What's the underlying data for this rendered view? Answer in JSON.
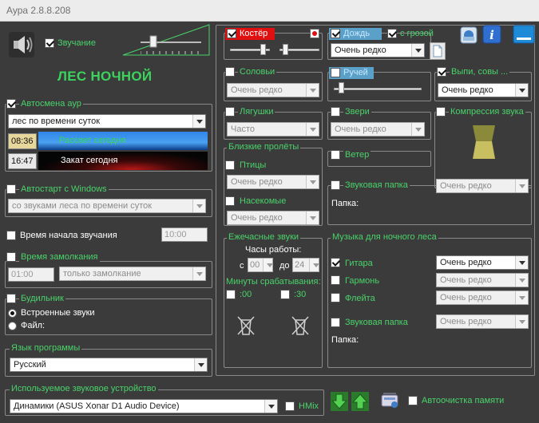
{
  "window": {
    "title": "Аура 2.8.8.208"
  },
  "left": {
    "sound_label": "Звучание",
    "aura_name": "ЛЕС НОЧНОЙ",
    "autochange": {
      "label": "Автосмена аур",
      "combo": "лес по времени суток",
      "sunrise_time": "08:36",
      "sunrise_label": "Рассвет сегодня",
      "sunset_time": "16:47",
      "sunset_label": "Закат сегодня"
    },
    "autostart": {
      "label": "Автостарт с Windows",
      "combo": "со звуками леса по времени суток"
    },
    "start_time": {
      "label": "Время начала звучания",
      "value": "10:00"
    },
    "stop_time": {
      "label": "Время замолкания",
      "value": "01:00",
      "combo": "только замолкание"
    },
    "alarm": {
      "label": "Будильник",
      "opt1": "Встроенные звуки",
      "opt2": "Файл:"
    },
    "language": {
      "label": "Язык программы",
      "value": "Русский"
    },
    "device": {
      "label": "Используемое звуковое устройство",
      "value": "Динамики (ASUS Xonar D1 Audio Device)",
      "hmix": "HMix"
    }
  },
  "middle": {
    "fire": {
      "label": "Костёр"
    },
    "nightingales": {
      "label": "Соловьи",
      "combo": "Очень редко"
    },
    "frogs": {
      "label": "Лягушки",
      "combo": "Часто"
    },
    "flyby": {
      "label": "Близкие пролёты",
      "birds": "Птицы",
      "birds_combo": "Очень редко",
      "insects": "Насекомые",
      "insects_combo": "Очень редко"
    },
    "hourly": {
      "label": "Ежечасные звуки",
      "hours": "Часы работы:",
      "from": "с",
      "from_val": "00",
      "to": "до",
      "to_val": "24",
      "minutes": "Минуты срабатывания:",
      "m1": ":00",
      "m2": ":30"
    }
  },
  "right": {
    "rain": {
      "label": "Дождь",
      "thunder": "с грозой",
      "combo": "Очень редко"
    },
    "stream": {
      "label": "Ручей"
    },
    "owls": {
      "label": "Выпи, совы ...",
      "combo": "Очень редко"
    },
    "animals": {
      "label": "Звери",
      "combo": "Очень редко"
    },
    "compression": {
      "label": "Компрессия звука"
    },
    "wind": {
      "label": "Ветер"
    },
    "folder": {
      "label": "Звуковая папка",
      "combo": "Очень редко",
      "path": "Папка:"
    },
    "music": {
      "label": "Музыка для ночного леса",
      "guitar": "Гитара",
      "guitar_combo": "Очень редко",
      "accordion": "Гармонь",
      "accordion_combo": "Очень редко",
      "flute": "Флейта",
      "flute_combo": "Очень редко",
      "folder": "Звуковая папка",
      "folder_combo": "Очень редко",
      "path": "Папка:"
    },
    "autoclean": "Автоочистка памяти"
  },
  "colors": {
    "accent_green": "#49d36a",
    "title_green": "#3bd45d",
    "fire_red": "#e01010",
    "rain_blue": "#5aa0c8",
    "background": "#3b3b3b"
  }
}
